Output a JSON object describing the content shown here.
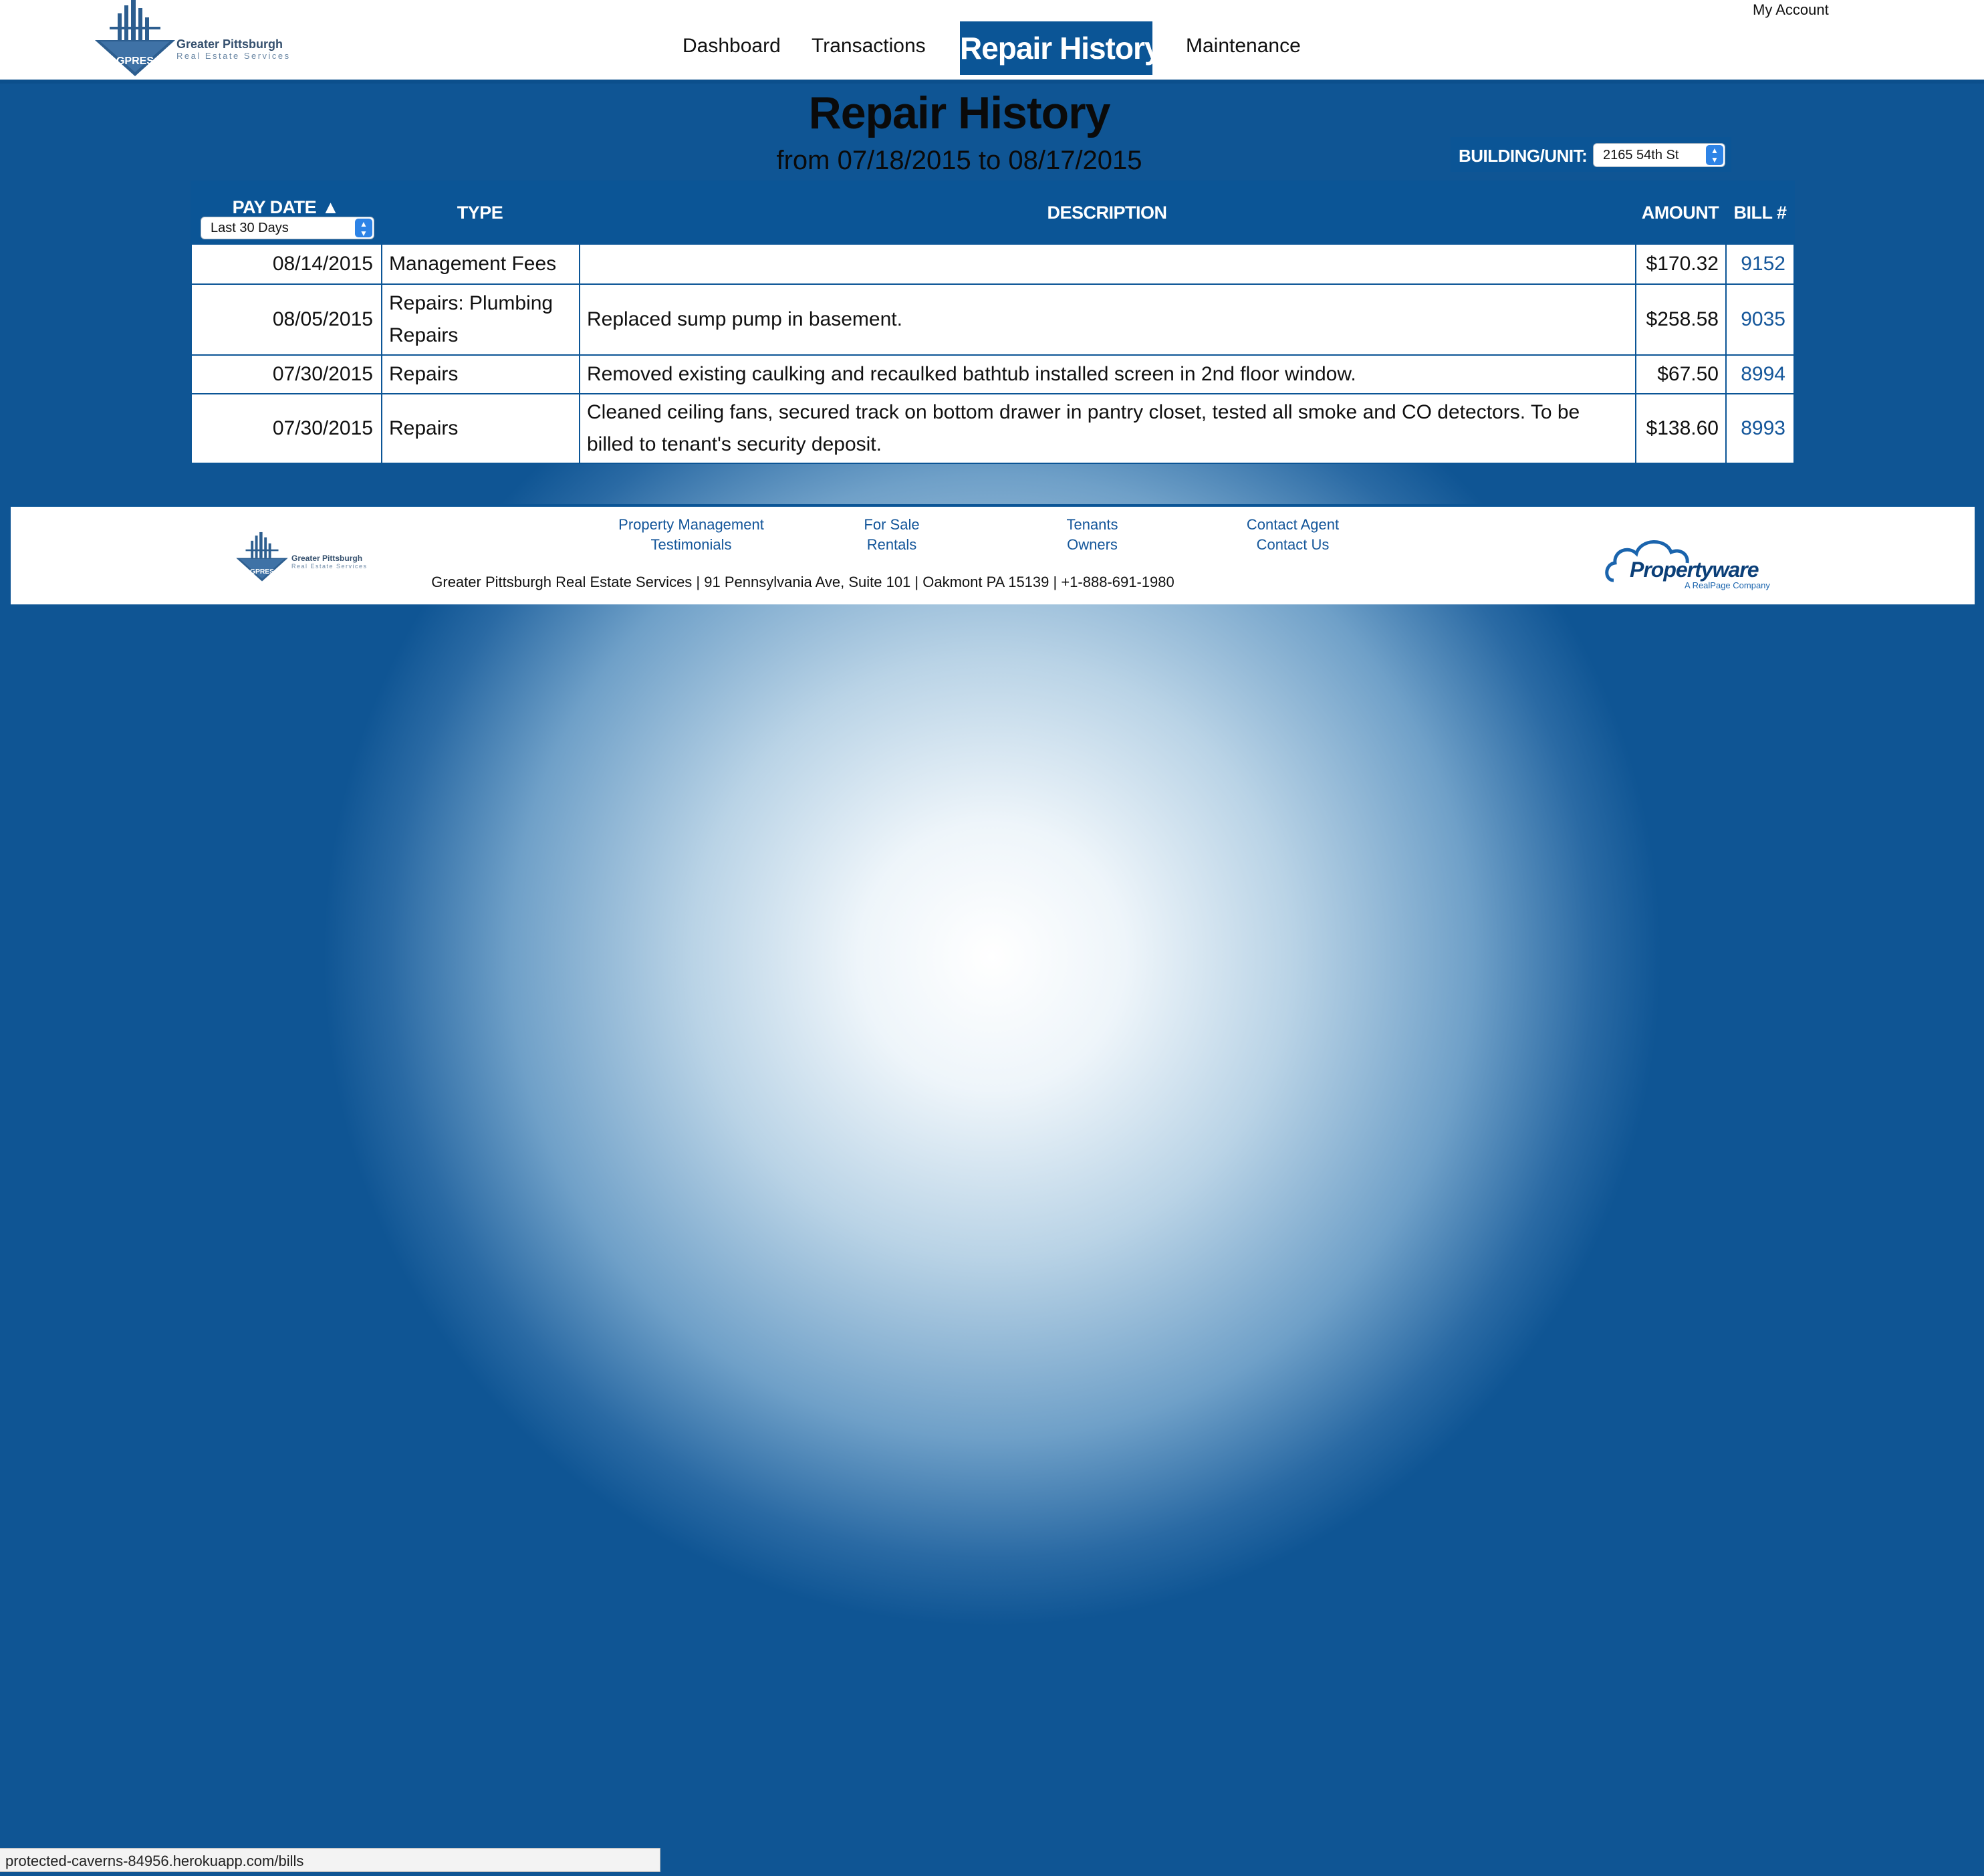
{
  "brand": {
    "name_line1": "Greater Pittsburgh",
    "name_line2": "Real Estate Services",
    "abbr": "GPRES",
    "color": "#0b5596"
  },
  "header": {
    "nav": [
      "Dashboard",
      "Transactions",
      "Repair History",
      "Maintenance"
    ],
    "active": "Repair History",
    "my_account": "My Account"
  },
  "page": {
    "title": "Repair History",
    "subtitle": "from 07/18/2015 to 08/17/2015"
  },
  "building": {
    "label": "BUILDING/UNIT:",
    "selected": "2165 54th St"
  },
  "table": {
    "columns": {
      "pay_date": "PAY DATE",
      "sort_indicator": "▲",
      "type": "TYPE",
      "description": "DESCRIPTION",
      "amount": "AMOUNT",
      "bill": "BILL #"
    },
    "date_filter": "Last 30 Days",
    "rows": [
      {
        "date": "08/14/2015",
        "type": "Management Fees",
        "description": "",
        "amount": "$170.32",
        "bill": "9152"
      },
      {
        "date": "08/05/2015",
        "type": "Repairs: Plumbing Repairs",
        "description": "Replaced sump pump in basement.",
        "amount": "$258.58",
        "bill": "9035"
      },
      {
        "date": "07/30/2015",
        "type": "Repairs",
        "description": "Removed existing caulking and recaulked bathtub installed screen in 2nd floor window.",
        "amount": "$67.50",
        "bill": "8994"
      },
      {
        "date": "07/30/2015",
        "type": "Repairs",
        "description": "Cleaned ceiling fans, secured track on bottom drawer in pantry closet, tested all smoke and CO detectors. To be billed to tenant's security deposit.",
        "amount": "$138.60",
        "bill": "8993"
      }
    ]
  },
  "footer": {
    "links": [
      [
        "Property Management",
        "Testimonials"
      ],
      [
        "For Sale",
        "Rentals"
      ],
      [
        "Tenants",
        "Owners"
      ],
      [
        "Contact Agent",
        "Contact Us"
      ]
    ],
    "address": "Greater Pittsburgh Real Estate Services | 91 Pennsylvania Ave, Suite 101 | Oakmont PA 15139 | +1-888-691-1980",
    "partner": "Propertyware",
    "partner_tagline": "A RealPage Company"
  },
  "statusbar": {
    "url": "protected-caverns-84956.herokuapp.com/bills"
  }
}
